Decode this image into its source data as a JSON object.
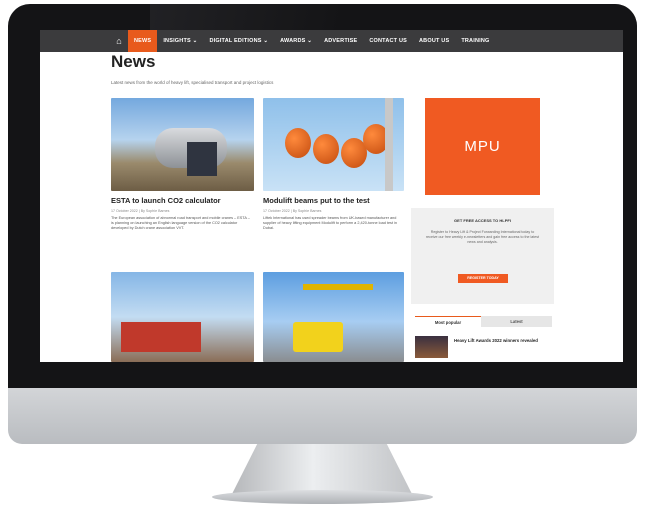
{
  "nav": {
    "items": [
      {
        "label": "NEWS",
        "active": true
      },
      {
        "label": "INSIGHTS ⌄",
        "active": false
      },
      {
        "label": "DIGITAL EDITIONS ⌄",
        "active": false
      },
      {
        "label": "AWARDS ⌄",
        "active": false
      },
      {
        "label": "ADVERTISE",
        "active": false
      },
      {
        "label": "CONTACT US",
        "active": false
      },
      {
        "label": "ABOUT US",
        "active": false
      },
      {
        "label": "TRAINING",
        "active": false
      }
    ],
    "home_icon": "home-icon"
  },
  "page": {
    "title": "News",
    "subtitle": "Latest news from the world of heavy lift, specialised transport and project logistics"
  },
  "articles": [
    {
      "headline": "ESTA to launch CO2 calculator",
      "meta": "17 October 2022 | By Sophie Barnes",
      "excerpt": "The European association of abnormal road transport and mobile cranes – ESTA – is planning on launching an English language version of the CO2 calculator developed by Dutch crane association VVT."
    },
    {
      "headline": "Modulift beams put to the test",
      "meta": "17 October 2022 | By Sophie Barnes",
      "excerpt": "Liftek International has used spreader beams from UK-based manufacturer and supplier of heavy lifting equipment Modulift to perform a 2,420-tonne load test in Dubai."
    },
    {
      "headline": "",
      "meta": "",
      "excerpt": ""
    },
    {
      "headline": "",
      "meta": "",
      "excerpt": ""
    }
  ],
  "sidebar": {
    "mpu_label": "MPU",
    "access_title": "GET FREE ACCESS TO HLPFI",
    "access_text": "Register to Heavy Lift & Project Forwarding International today to receive our free weekly e-newsletters and gain free access to the latest news and analysis.",
    "access_button": "REGISTER TODAY",
    "tabs": [
      "Most popular",
      "Latest"
    ],
    "popular_items": [
      "Heavy Lift Awards 2022 winners revealed"
    ]
  },
  "colors": {
    "accent": "#e85a1c",
    "nav_bg": "#3b3b3d"
  }
}
